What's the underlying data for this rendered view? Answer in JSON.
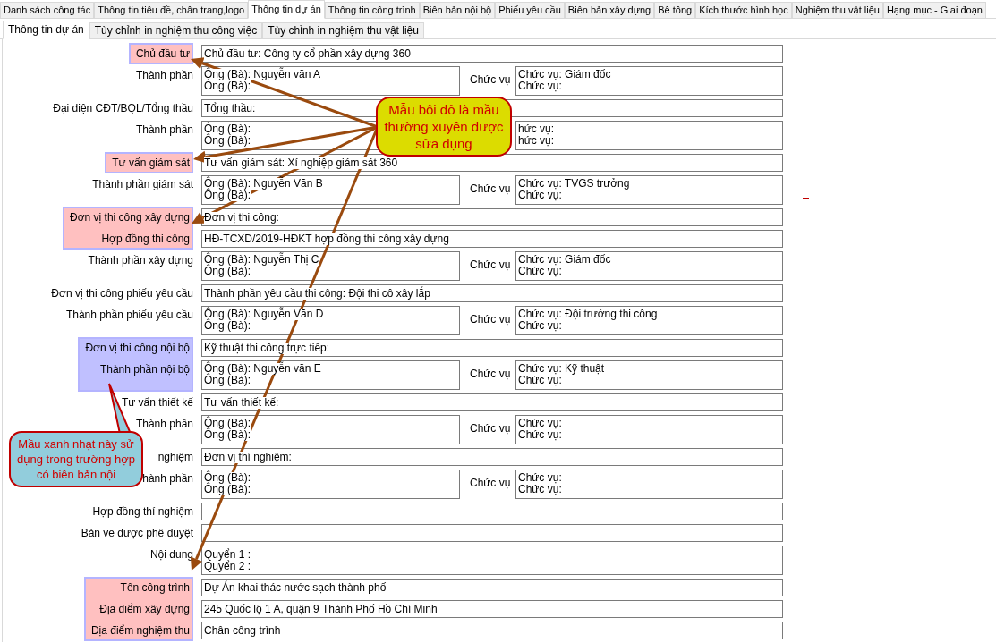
{
  "tabs": [
    {
      "label": "Danh sách công tác",
      "selected": false
    },
    {
      "label": "Thông tin tiêu đề, chân trang,logo",
      "selected": false
    },
    {
      "label": "Thông tin dự án",
      "selected": true
    },
    {
      "label": "Thông tin công trình",
      "selected": false
    },
    {
      "label": "Biên bản nội bộ",
      "selected": false
    },
    {
      "label": "Phiếu yêu cầu",
      "selected": false
    },
    {
      "label": "Biên bản xây dựng",
      "selected": false
    },
    {
      "label": "Bê tông",
      "selected": false
    },
    {
      "label": "Kích thước hình học",
      "selected": false
    },
    {
      "label": "Nghiệm thu vật liệu",
      "selected": false
    },
    {
      "label": "Hạng mục - Giai đoạn",
      "selected": false
    }
  ],
  "subtabs": [
    {
      "label": "Thông tin dự án",
      "selected": true
    },
    {
      "label": "Tùy chỉnh in nghiệm thu công việc",
      "selected": false
    },
    {
      "label": "Tùy chỉnh in nghiệm thu vật liệu",
      "selected": false
    }
  ],
  "groups": [
    {
      "color": "#ffc0c0",
      "rows": [
        {
          "kind": "single",
          "label": "Chủ đầu tư",
          "value": "Chủ đầu tư: Công ty cổ phần xây dựng 360"
        }
      ]
    },
    {
      "rows": [
        {
          "kind": "person",
          "label": "Thành phần",
          "names": [
            "Ông (Bà): Nguyễn văn A",
            "Ông (Bà):"
          ],
          "position_label": "Chức vụ",
          "positions": [
            "Chức vụ: Giám đốc",
            "Chức vụ:"
          ]
        }
      ]
    },
    {
      "rows": [
        {
          "kind": "single",
          "label": "Đại diện CĐT/BQL/Tổng thầu",
          "value": "Tổng thầu:"
        }
      ]
    },
    {
      "rows": [
        {
          "kind": "person",
          "label": "Thành phần",
          "names": [
            "Ông (Bà):",
            "Ông (Bà):"
          ],
          "positions": [
            "hức vụ:",
            "hức vụ:"
          ]
        }
      ]
    },
    {
      "color": "#ffc0c0",
      "rows": [
        {
          "kind": "single",
          "label": "Tư vấn giám sát",
          "value": "Tư vấn giám sát: Xí nghiệp giám sát 360"
        }
      ]
    },
    {
      "rows": [
        {
          "kind": "person",
          "label": "Thành phần giám sát",
          "names": [
            "Ông (Bà): Nguyễn Văn B",
            "Ông (Bà):"
          ],
          "position_label": "Chức vụ",
          "positions": [
            "Chức vụ: TVGS trưởng",
            "Chức vụ:"
          ]
        }
      ]
    },
    {
      "color": "#ffc0c0",
      "rows": [
        {
          "kind": "single",
          "label": "Đơn vị thi công xây dựng",
          "value": "Đơn vị thi công:"
        },
        {
          "kind": "single",
          "label": "Hợp đồng thi công",
          "value": "HĐ-TCXD/2019-HĐKT hợp đồng thi công xây dựng"
        }
      ]
    },
    {
      "rows": [
        {
          "kind": "person",
          "label": "Thành phần xây dựng",
          "names": [
            "Ông (Bà): Nguyễn Thị C",
            "Ông (Bà):"
          ],
          "position_label": "Chức vụ",
          "positions": [
            "Chức vụ: Giám đốc",
            "Chức vụ:"
          ]
        }
      ]
    },
    {
      "rows": [
        {
          "kind": "single",
          "label": "Đơn vị thi công phiếu yêu cầu",
          "value": "Thành phần yêu cầu thi công: Đội thi cô xây lắp"
        }
      ]
    },
    {
      "rows": [
        {
          "kind": "person",
          "label": "Thành phần phiếu yêu cầu",
          "names": [
            "Ông (Bà): Nguyễn Văn D",
            "Ông (Bà):"
          ],
          "position_label": "Chức vụ",
          "positions": [
            "Chức vụ: Đội trưởng thi công",
            "Chức vụ:"
          ]
        }
      ]
    },
    {
      "color": "#c0c0ff",
      "rows": [
        {
          "kind": "single",
          "label": "Đơn vị thi công nội bộ",
          "value": "Kỹ thuật thi công trực tiếp:"
        },
        {
          "kind": "person",
          "label": "Thành phần nội bộ",
          "names": [
            "Ông (Bà): Nguyễn văn E",
            "Ông (Bà):"
          ],
          "position_label": "Chức vụ",
          "positions": [
            "Chức vụ: Kỹ thuật",
            "Chức vụ:"
          ]
        }
      ]
    },
    {
      "rows": [
        {
          "kind": "single",
          "label": "Tư vấn thiết kế",
          "value": "Tư vấn thiết kế:"
        }
      ]
    },
    {
      "rows": [
        {
          "kind": "person",
          "label": "Thành phần",
          "names": [
            "Ông (Bà):",
            "Ông (Bà):"
          ],
          "position_label": "Chức vụ",
          "positions": [
            "Chức vụ:",
            "Chức vụ:"
          ]
        }
      ]
    },
    {
      "rows": [
        {
          "kind": "single",
          "label": "nghiệm",
          "value": "Đơn vị thí nghiệm:"
        }
      ]
    },
    {
      "rows": [
        {
          "kind": "person",
          "label": "hành phần",
          "names": [
            "Ông (Bà):",
            "Ông (Bà):"
          ],
          "position_label": "Chức vụ",
          "positions": [
            "Chức vụ:",
            "Chức vụ:"
          ]
        }
      ]
    },
    {
      "rows": [
        {
          "kind": "single",
          "label": "Hợp đồng thí nghiệm"
        }
      ]
    },
    {
      "rows": [
        {
          "kind": "single",
          "label": "Bản vẽ được phê duyệt"
        }
      ]
    },
    {
      "rows": [
        {
          "kind": "multi",
          "label": "Nội dung",
          "lines": [
            "Quyển 1 :",
            "Quyển 2 :"
          ]
        }
      ]
    },
    {
      "color": "#ffc0c0",
      "rows": [
        {
          "kind": "single",
          "label": "Tên công trình",
          "value": "Dự Án khai thác nước sạch thành phố"
        },
        {
          "kind": "single",
          "label": "Địa điểm xây dựng",
          "value": "245 Quốc lộ 1 A, quận 9 Thành Phố Hồ Chí Minh"
        },
        {
          "kind": "single",
          "label": "Địa điểm nghiệm thu",
          "value": "Chân công trình"
        }
      ]
    }
  ],
  "callouts": [
    {
      "text": "Mẫu bôi đỏ là mầu thường xuyên được sửa dụng",
      "color": "#dcdc00"
    },
    {
      "text": "Mầu xanh nhạt này sử dụng trong trường hợp có biên bản nội",
      "color": "#92cddc"
    }
  ]
}
